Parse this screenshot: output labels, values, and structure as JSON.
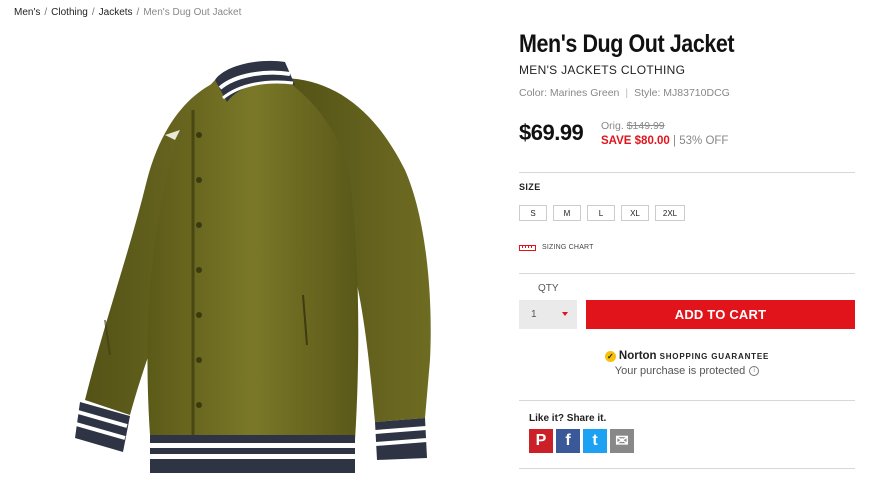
{
  "breadcrumb": {
    "items": [
      "Men's",
      "Clothing",
      "Jackets"
    ],
    "separator": "/",
    "current": "Men's Dug Out Jacket"
  },
  "product": {
    "title": "Men's Dug Out Jacket",
    "subtitle": "MEN'S JACKETS CLOTHING",
    "color_label": "Color: Marines Green",
    "style_label": "Style: MJ83710DCG",
    "price": "$69.99",
    "orig_label": "Orig.",
    "orig_price": "$149.99",
    "save_text": "SAVE $80.00",
    "discount": "53% OFF",
    "image_icon": "olive-jacket-image",
    "colors": {
      "accent": "#e1141b",
      "jacket": "#6b6a22"
    }
  },
  "size": {
    "label": "SIZE",
    "options": [
      "S",
      "M",
      "L",
      "XL",
      "2XL"
    ],
    "chart_label": "SIZING CHART"
  },
  "qty": {
    "label": "QTY",
    "value": "1"
  },
  "cart": {
    "label": "ADD TO CART"
  },
  "norton": {
    "brand": "Norton",
    "guarantee": "SHOPPING GUARANTEE",
    "sub": "Your purchase is protected",
    "info": "i"
  },
  "share": {
    "title": "Like it? Share it.",
    "icons": [
      {
        "name": "pinterest-icon",
        "glyph": "P",
        "color": "#cb2027"
      },
      {
        "name": "facebook-icon",
        "glyph": "f",
        "color": "#3b5998"
      },
      {
        "name": "twitter-icon",
        "glyph": "t",
        "color": "#1da1f2"
      },
      {
        "name": "email-icon",
        "glyph": "✉",
        "color": "#888888"
      }
    ]
  }
}
